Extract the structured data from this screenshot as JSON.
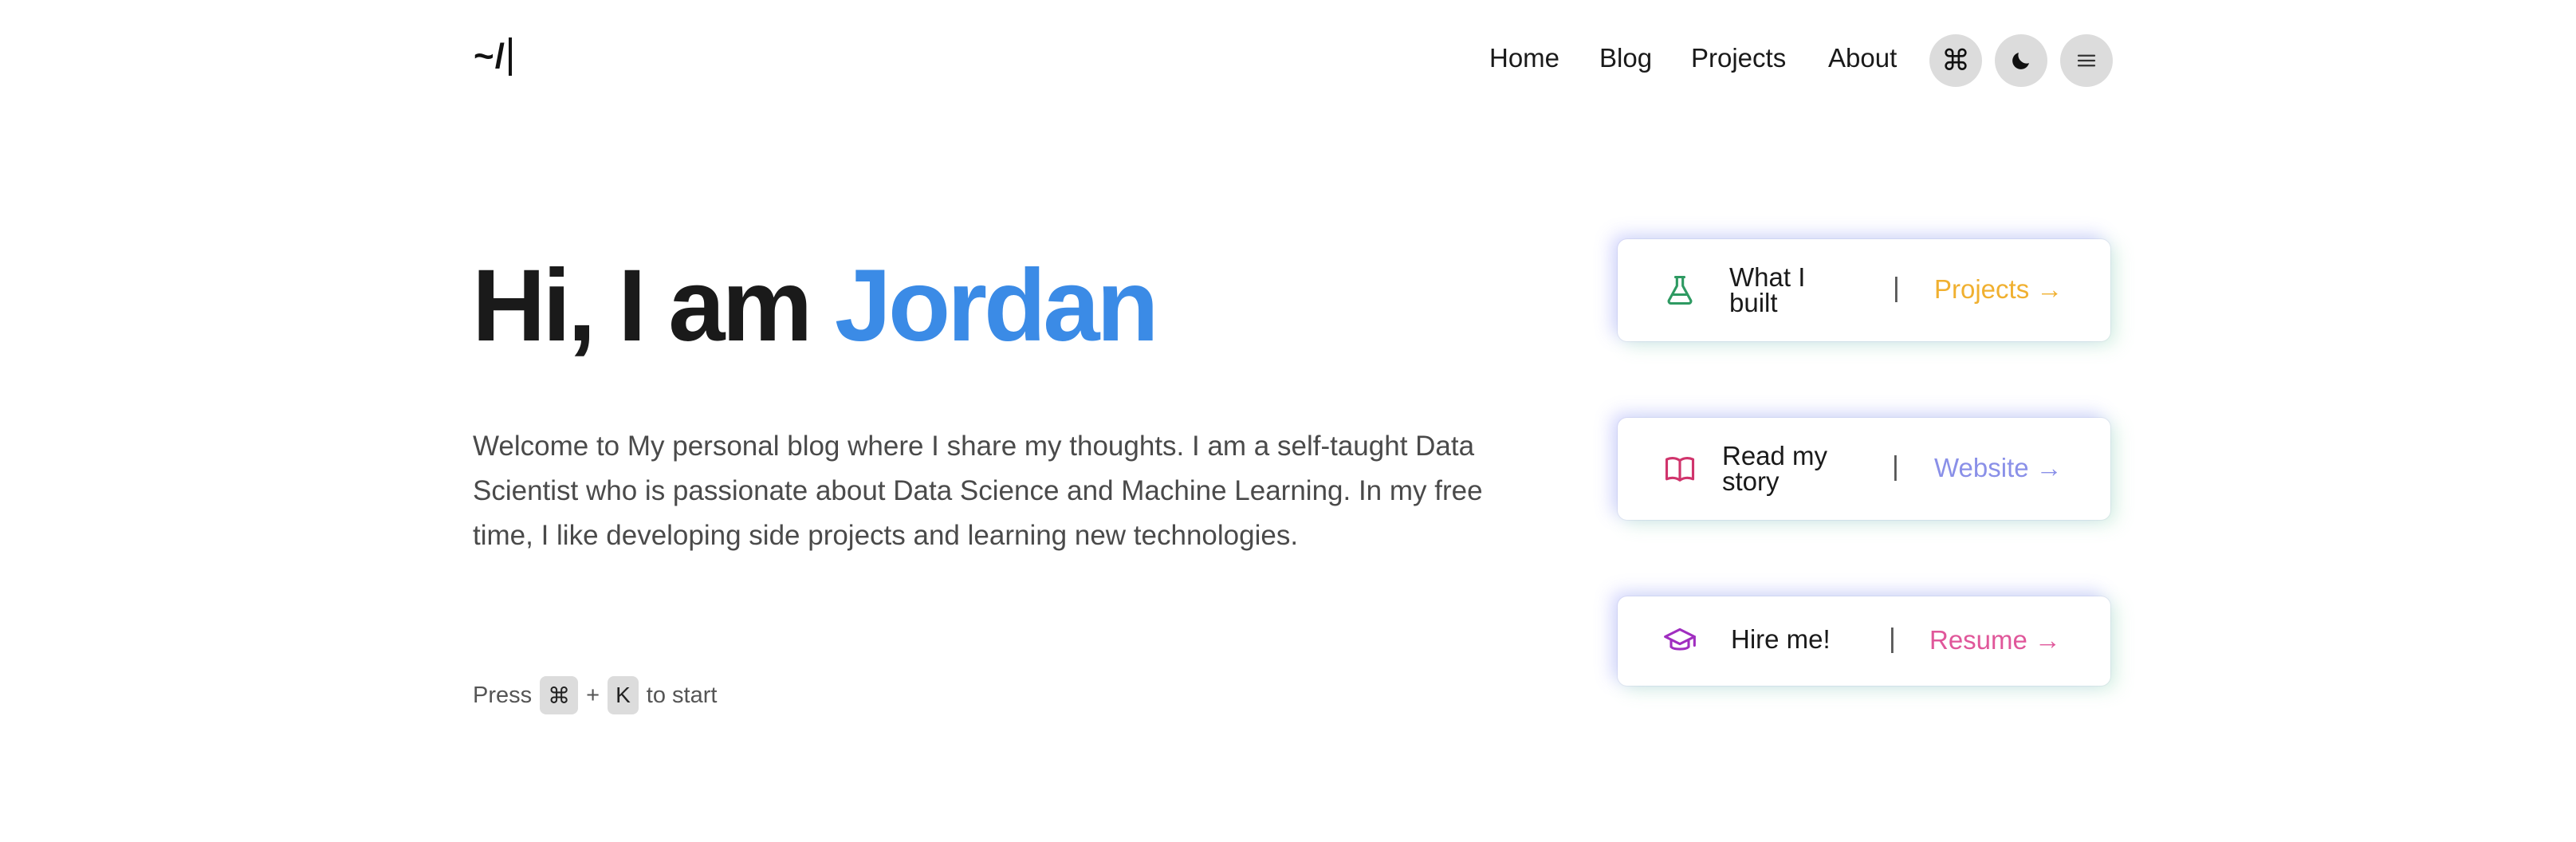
{
  "header": {
    "logo": "~/",
    "nav": [
      {
        "label": "Home"
      },
      {
        "label": "Blog"
      },
      {
        "label": "Projects"
      },
      {
        "label": "About"
      }
    ],
    "command_button_glyph": "⌘",
    "icons": [
      "command-icon",
      "moon-icon",
      "menu-icon"
    ]
  },
  "hero": {
    "greeting": "Hi, I am ",
    "name": "Jordan",
    "name_color": "#3b8be6",
    "intro": "Welcome to My personal blog where I share my thoughts. I am a self-taught Data Scientist who is passionate about Data Science and Machine Learning. In my free time, I like developing side projects and learning new technologies."
  },
  "press_hint": {
    "prefix": "Press",
    "key1": "⌘",
    "plus": "+",
    "key2": "K",
    "suffix": "to start"
  },
  "cards": [
    {
      "label": "What I built",
      "separator": "|",
      "link": "Projects →",
      "link_color": "#f0b030",
      "icon": "flask-icon",
      "icon_color": "#2e9a62"
    },
    {
      "label": "Read my story",
      "separator": "|",
      "link": "Website →",
      "link_color": "#8a90e8",
      "icon": "book-icon",
      "icon_color": "#d0346c"
    },
    {
      "label": "Hire me!",
      "separator": "|",
      "link": "Resume →",
      "link_color": "#e0579a",
      "icon": "graduation-cap-icon",
      "icon_color": "#a02ec0"
    }
  ]
}
